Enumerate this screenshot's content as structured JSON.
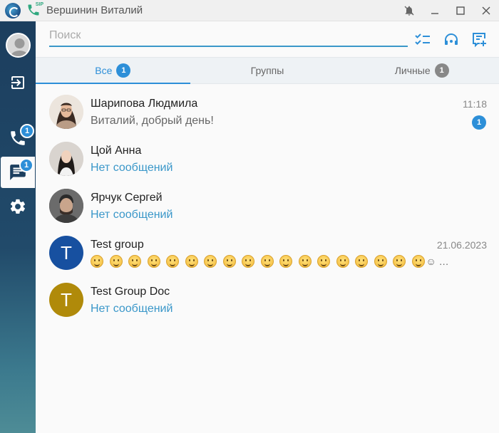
{
  "window": {
    "title": "Вершинин Виталий",
    "sip_label": "SIP"
  },
  "search": {
    "placeholder": "Поиск",
    "value": ""
  },
  "tabs": [
    {
      "label": "Все",
      "badge": "1",
      "active": true
    },
    {
      "label": "Группы",
      "badge": "",
      "active": false
    },
    {
      "label": "Личные",
      "badge": "1",
      "active": false
    }
  ],
  "sidebar": {
    "calls_badge": "1",
    "chats_badge": "1"
  },
  "chats": [
    {
      "name": "Шарипова Людмила",
      "message": "Виталий, добрый день!",
      "time": "11:18",
      "unread": "1"
    },
    {
      "name": "Цой Анна",
      "message": "Нет сообщений",
      "time": "",
      "unread": ""
    },
    {
      "name": "Ярчук Сергей",
      "message": "Нет сообщений",
      "time": "",
      "unread": ""
    },
    {
      "name": "Test group",
      "avatar_letter": "T",
      "avatar_color": "#1750a0",
      "time": "21.06.2023",
      "emoji_more": "☺ …"
    },
    {
      "name": "Test Group Doc",
      "avatar_letter": "T",
      "avatar_color": "#b08a0a",
      "message": "Нет сообщений",
      "time": "",
      "unread": ""
    }
  ],
  "colors": {
    "accent": "#2d8fd8",
    "link": "#3a97c9",
    "sidebar": "#1c3e5e"
  }
}
